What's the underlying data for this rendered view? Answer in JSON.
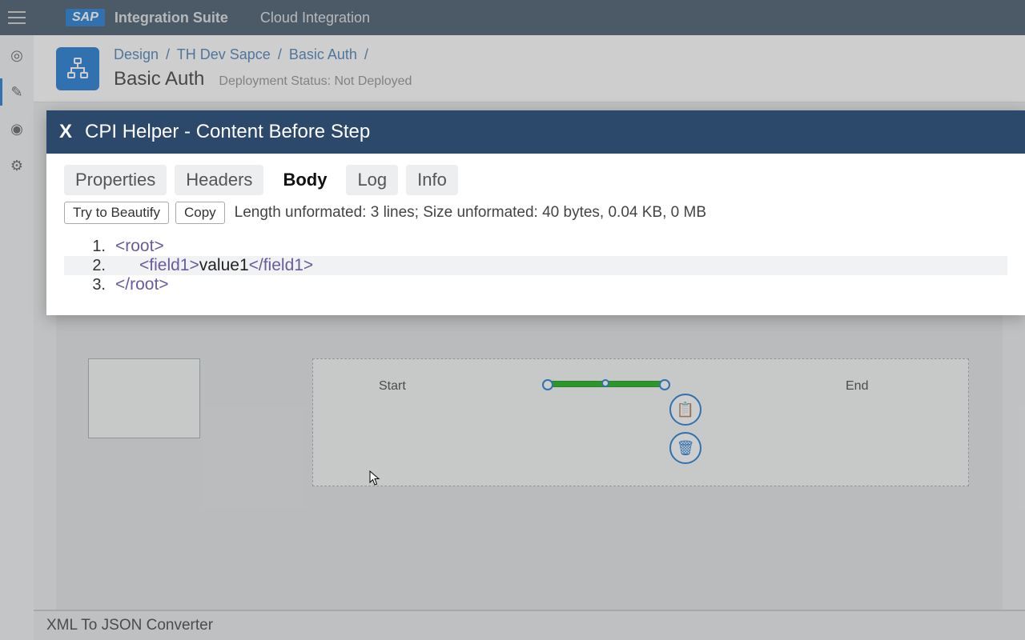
{
  "topbar": {
    "logo": "SAP",
    "suite": "Integration Suite",
    "product": "Cloud Integration"
  },
  "crumbs": {
    "c1": "Design",
    "c2": "TH Dev Sapce",
    "c3": "Basic Auth",
    "sep": "/"
  },
  "page": {
    "title": "Basic Auth",
    "deploy": "Deployment Status: Not Deployed"
  },
  "diagram": {
    "start": "Start",
    "end": "End"
  },
  "footer": {
    "panel_title": "XML To JSON Converter"
  },
  "cpi": {
    "close": "X",
    "title": "CPI Helper - Content Before Step",
    "tabs": {
      "properties": "Properties",
      "headers": "Headers",
      "body": "Body",
      "log": "Log",
      "info": "Info"
    },
    "btn_beautify": "Try to Beautify",
    "btn_copy": "Copy",
    "length_info": "Length unformated: 3 lines; Size unformated: 40 bytes, 0.04 KB, 0 MB",
    "code": {
      "l1_tag": "<root>",
      "l2_tag_open": "<field1>",
      "l2_val": "value1",
      "l2_tag_close": "</field1>",
      "l3_tag": "</root>"
    }
  }
}
